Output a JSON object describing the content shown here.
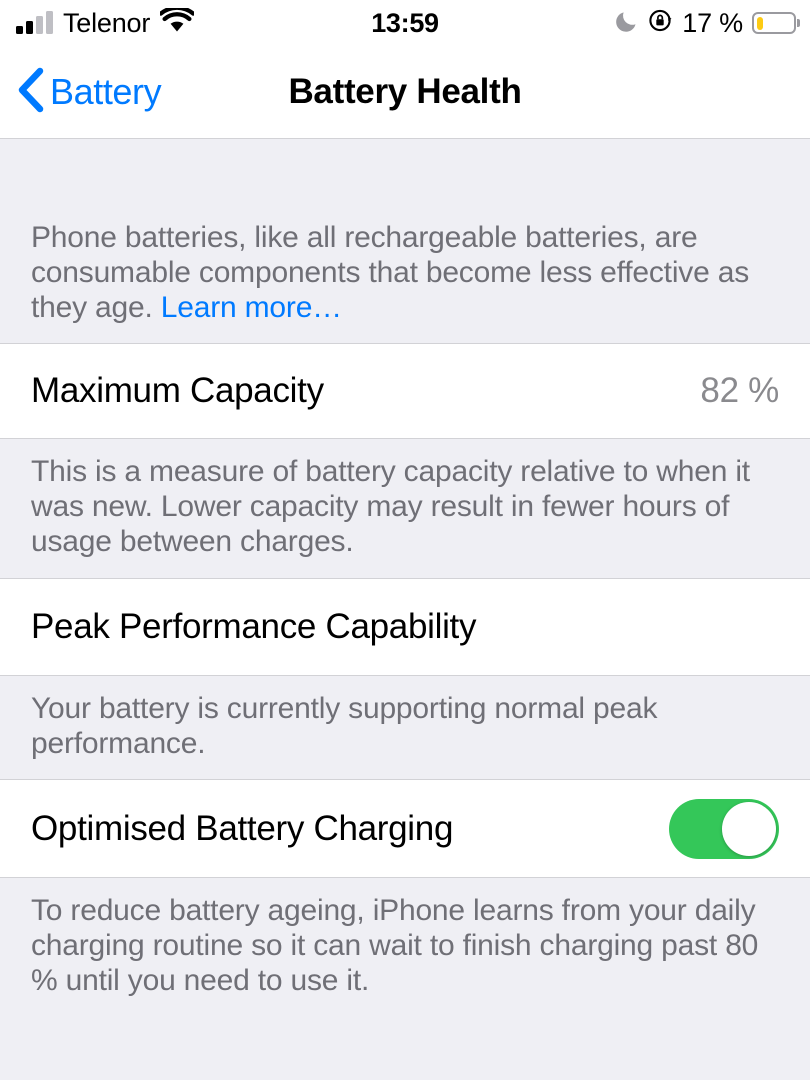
{
  "status_bar": {
    "carrier": "Telenor",
    "signal_icon": "cellular-signal-icon",
    "signal_bars_total": 4,
    "signal_bars_filled": 2,
    "wifi_icon": "wifi-icon",
    "time": "13:59",
    "dnd_icon": "moon-do-not-disturb-icon",
    "rotation_lock_icon": "rotation-lock-icon",
    "battery_percent": "17 %",
    "battery_icon": "battery-low-power-icon",
    "battery_level": 17,
    "battery_fill_color": "#FDCB14"
  },
  "nav_bar": {
    "back_icon": "chevron-left-icon",
    "back_label": "Battery",
    "title": "Battery Health",
    "tint_color": "#007AFF"
  },
  "sections": {
    "intro": {
      "text": "Phone batteries, like all rechargeable batteries, are consumable components that become less effective as they age. ",
      "link_label": "Learn more…"
    },
    "maximum_capacity": {
      "title": "Maximum Capacity",
      "value": "82 %",
      "footer": "This is a measure of battery capacity relative to when it was new. Lower capacity may result in fewer hours of usage between charges."
    },
    "peak_performance": {
      "title": "Peak Performance Capability",
      "footer": "Your battery is currently supporting normal peak performance."
    },
    "optimised_charging": {
      "title": "Optimised Battery Charging",
      "toggle_state": "on",
      "toggle_color": "#34C759",
      "footer": "To reduce battery ageing, iPhone learns from your daily charging routine so it can wait to finish charging past 80 % until you need to use it."
    }
  }
}
